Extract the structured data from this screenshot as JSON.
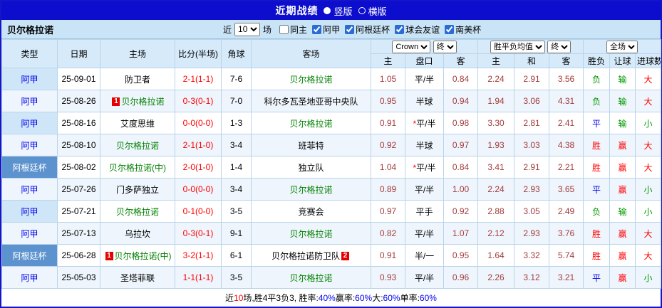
{
  "colors": {
    "frame_border": "#1414c8",
    "title_bar_bg": "#0d0dce",
    "filter_bar_bg": "#c9e3f7",
    "header_bg": "#d6eafa",
    "stripe_bg": "#eef5fc",
    "league_cell_bg": "#cfe6f8",
    "cup_cell_bg": "#5c93cf",
    "target_team": "#008000",
    "score": "#ff0000",
    "odds": "#a33c3c",
    "win": "#ff0000",
    "draw": "#0000ee",
    "lose": "#009900"
  },
  "title_bar": {
    "title": "近期战绩",
    "vertical_option": "竖版",
    "horizontal_option": "横版"
  },
  "filter_bar": {
    "team_name": "贝尔格拉诺",
    "near_label": "近",
    "count_value": "10",
    "unit_label": "场",
    "checkboxes": [
      {
        "key": "same-home",
        "label": "同主",
        "checked": false
      },
      {
        "key": "liga",
        "label": "阿甲",
        "checked": true
      },
      {
        "key": "argentina-cup",
        "label": "阿根廷杯",
        "checked": true
      },
      {
        "key": "club-friendly",
        "label": "球会友谊",
        "checked": true
      },
      {
        "key": "copa-sudamericana",
        "label": "南美杯",
        "checked": true
      }
    ]
  },
  "table": {
    "headers": {
      "type": "类型",
      "date": "日期",
      "home": "主场",
      "score": "比分(半场)",
      "corner": "角球",
      "away": "客场",
      "asian_home": "主",
      "asian_handicap": "盘口",
      "asian_away": "客",
      "euro_home": "主",
      "euro_draw": "和",
      "euro_away": "客",
      "result": "胜负",
      "handicap_result": "让球",
      "goals": "进球数"
    },
    "selects": {
      "company": "Crown",
      "asian_stage": "终",
      "europe": "胜平负均值",
      "europe_stage": "终",
      "scope": "全场"
    },
    "rows": [
      {
        "league": "阿甲",
        "is_cup": false,
        "date": "25-09-01",
        "home": "防卫者",
        "home_is_target": false,
        "home_red_card": "",
        "score": "2-1(1-1)",
        "corner": "7-6",
        "away": "贝尔格拉诺",
        "away_is_target": true,
        "away_red_card": "",
        "asian_home": "1.05",
        "handicap": "平/半",
        "handicap_star": false,
        "asian_away": "0.84",
        "euro_home": "2.24",
        "euro_draw": "2.91",
        "euro_away": "3.56",
        "result": "负",
        "result_kind": "lose",
        "handicap_result": "输",
        "handicap_result_kind": "lose",
        "goals": "大",
        "goals_kind": "big"
      },
      {
        "league": "阿甲",
        "is_cup": false,
        "date": "25-08-26",
        "home": "贝尔格拉诺",
        "home_is_target": true,
        "home_red_card": "1",
        "score": "0-3(0-1)",
        "corner": "7-0",
        "away": "科尔多瓦圣地亚哥中央队",
        "away_is_target": false,
        "away_red_card": "",
        "asian_home": "0.95",
        "handicap": "半球",
        "handicap_star": false,
        "asian_away": "0.94",
        "euro_home": "1.94",
        "euro_draw": "3.06",
        "euro_away": "4.31",
        "result": "负",
        "result_kind": "lose",
        "handicap_result": "输",
        "handicap_result_kind": "lose",
        "goals": "大",
        "goals_kind": "big"
      },
      {
        "league": "阿甲",
        "is_cup": false,
        "date": "25-08-16",
        "home": "艾度思维",
        "home_is_target": false,
        "home_red_card": "",
        "score": "0-0(0-0)",
        "corner": "1-3",
        "away": "贝尔格拉诺",
        "away_is_target": true,
        "away_red_card": "",
        "asian_home": "0.91",
        "handicap": "平/半",
        "handicap_star": true,
        "asian_away": "0.98",
        "euro_home": "3.30",
        "euro_draw": "2.81",
        "euro_away": "2.41",
        "result": "平",
        "result_kind": "draw",
        "handicap_result": "输",
        "handicap_result_kind": "lose",
        "goals": "小",
        "goals_kind": "small"
      },
      {
        "league": "阿甲",
        "is_cup": false,
        "date": "25-08-10",
        "home": "贝尔格拉诺",
        "home_is_target": true,
        "home_red_card": "",
        "score": "2-1(1-0)",
        "corner": "3-4",
        "away": "班菲特",
        "away_is_target": false,
        "away_red_card": "",
        "asian_home": "0.92",
        "handicap": "半球",
        "handicap_star": false,
        "asian_away": "0.97",
        "euro_home": "1.93",
        "euro_draw": "3.03",
        "euro_away": "4.38",
        "result": "胜",
        "result_kind": "win",
        "handicap_result": "赢",
        "handicap_result_kind": "win",
        "goals": "大",
        "goals_kind": "big"
      },
      {
        "league": "阿根廷杯",
        "is_cup": true,
        "date": "25-08-02",
        "home": "贝尔格拉诺(中)",
        "home_is_target": true,
        "home_red_card": "",
        "score": "2-0(1-0)",
        "corner": "1-4",
        "away": "独立队",
        "away_is_target": false,
        "away_red_card": "",
        "asian_home": "1.04",
        "handicap": "平/半",
        "handicap_star": true,
        "asian_away": "0.84",
        "euro_home": "3.41",
        "euro_draw": "2.91",
        "euro_away": "2.21",
        "result": "胜",
        "result_kind": "win",
        "handicap_result": "赢",
        "handicap_result_kind": "win",
        "goals": "大",
        "goals_kind": "big"
      },
      {
        "league": "阿甲",
        "is_cup": false,
        "date": "25-07-26",
        "home": "门多萨独立",
        "home_is_target": false,
        "home_red_card": "",
        "score": "0-0(0-0)",
        "corner": "3-4",
        "away": "贝尔格拉诺",
        "away_is_target": true,
        "away_red_card": "",
        "asian_home": "0.89",
        "handicap": "平/半",
        "handicap_star": false,
        "asian_away": "1.00",
        "euro_home": "2.24",
        "euro_draw": "2.93",
        "euro_away": "3.65",
        "result": "平",
        "result_kind": "draw",
        "handicap_result": "赢",
        "handicap_result_kind": "win",
        "goals": "小",
        "goals_kind": "small"
      },
      {
        "league": "阿甲",
        "is_cup": false,
        "date": "25-07-21",
        "home": "贝尔格拉诺",
        "home_is_target": true,
        "home_red_card": "",
        "score": "0-1(0-0)",
        "corner": "3-5",
        "away": "竞赛会",
        "away_is_target": false,
        "away_red_card": "",
        "asian_home": "0.97",
        "handicap": "平手",
        "handicap_star": false,
        "asian_away": "0.92",
        "euro_home": "2.88",
        "euro_draw": "3.05",
        "euro_away": "2.49",
        "result": "负",
        "result_kind": "lose",
        "handicap_result": "输",
        "handicap_result_kind": "lose",
        "goals": "小",
        "goals_kind": "small"
      },
      {
        "league": "阿甲",
        "is_cup": false,
        "date": "25-07-13",
        "home": "乌拉坎",
        "home_is_target": false,
        "home_red_card": "",
        "score": "0-3(0-1)",
        "corner": "9-1",
        "away": "贝尔格拉诺",
        "away_is_target": true,
        "away_red_card": "",
        "asian_home": "0.82",
        "handicap": "平/半",
        "handicap_star": false,
        "asian_away": "1.07",
        "euro_home": "2.12",
        "euro_draw": "2.93",
        "euro_away": "3.76",
        "result": "胜",
        "result_kind": "win",
        "handicap_result": "赢",
        "handicap_result_kind": "win",
        "goals": "大",
        "goals_kind": "big"
      },
      {
        "league": "阿根廷杯",
        "is_cup": true,
        "date": "25-06-28",
        "home": "贝尔格拉诺(中)",
        "home_is_target": true,
        "home_red_card": "1",
        "score": "3-2(1-1)",
        "corner": "6-1",
        "away": "贝尔格拉诺防卫队",
        "away_is_target": false,
        "away_red_card": "2",
        "asian_home": "0.91",
        "handicap": "半/一",
        "handicap_star": false,
        "asian_away": "0.95",
        "euro_home": "1.64",
        "euro_draw": "3.32",
        "euro_away": "5.74",
        "result": "胜",
        "result_kind": "win",
        "handicap_result": "赢",
        "handicap_result_kind": "win",
        "goals": "大",
        "goals_kind": "big"
      },
      {
        "league": "阿甲",
        "is_cup": false,
        "date": "25-05-03",
        "home": "圣塔菲联",
        "home_is_target": false,
        "home_red_card": "",
        "score": "1-1(1-1)",
        "corner": "3-5",
        "away": "贝尔格拉诺",
        "away_is_target": true,
        "away_red_card": "",
        "asian_home": "0.93",
        "handicap": "平/半",
        "handicap_star": false,
        "asian_away": "0.96",
        "euro_home": "2.26",
        "euro_draw": "3.12",
        "euro_away": "3.21",
        "result": "平",
        "result_kind": "draw",
        "handicap_result": "赢",
        "handicap_result_kind": "win",
        "goals": "小",
        "goals_kind": "small"
      }
    ]
  },
  "footer": {
    "parts": [
      {
        "text": "近",
        "color": ""
      },
      {
        "text": "10",
        "color": "red"
      },
      {
        "text": "场,胜4平3负3, 胜率:",
        "color": ""
      },
      {
        "text": "40%",
        "color": "blue"
      },
      {
        "text": " 赢率:",
        "color": ""
      },
      {
        "text": "60%",
        "color": "blue"
      },
      {
        "text": " 大:",
        "color": ""
      },
      {
        "text": "60%",
        "color": "blue"
      },
      {
        "text": " 单率:",
        "color": ""
      },
      {
        "text": "60%",
        "color": "blue"
      }
    ]
  }
}
